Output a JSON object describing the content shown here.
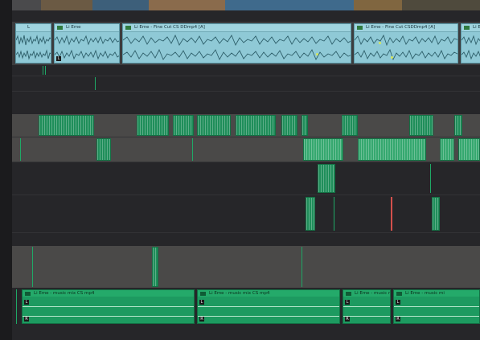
{
  "timeline": {
    "dialogue_clips": [
      {
        "label": "L"
      },
      {
        "label": "Li Eme"
      },
      {
        "label": "Li Eme - Fine Cut CS DDmp4 [A]"
      },
      {
        "label": "Li Eme - Fine Cut CSDDmp4 [A]"
      },
      {
        "label": "Li Eme"
      }
    ],
    "music_clips": [
      {
        "label": "Li Eme - music mix CS mp4"
      },
      {
        "label": "Li Eme - music mix CS mp4"
      },
      {
        "label": "Li Eme - music mix"
      },
      {
        "label": "Li Eme - music mi"
      }
    ],
    "clip_badges": {
      "left": "L",
      "right": "R"
    }
  },
  "colors": {
    "background": "#262629",
    "dialogue_clip": "#8fc9d6",
    "sfx_clip": "#1f8e5a",
    "music_clip": "#1d9a60",
    "marker": "#d4504c"
  }
}
